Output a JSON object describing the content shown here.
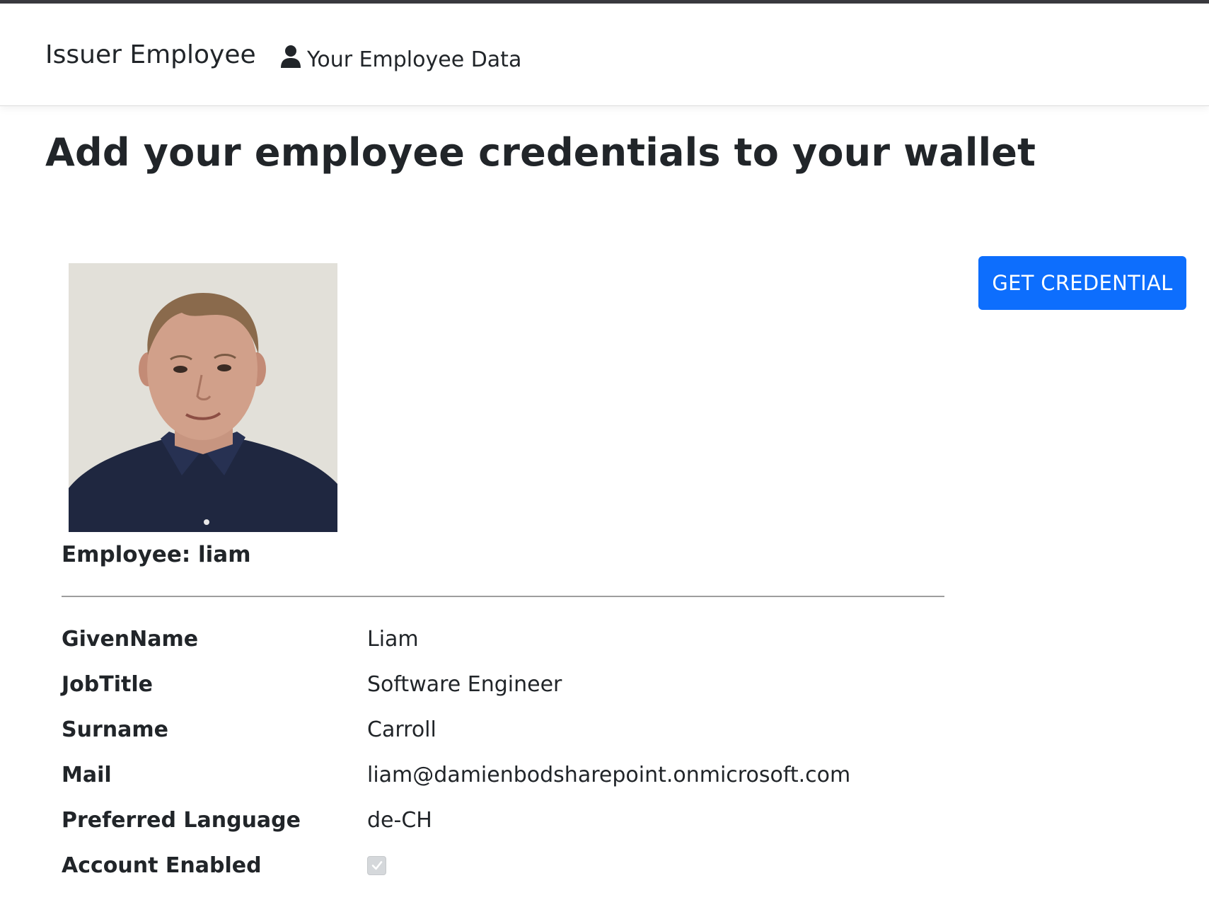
{
  "navbar": {
    "brand": "Issuer Employee",
    "link_label": "Your Employee Data",
    "link_icon": "person-icon"
  },
  "main": {
    "title": "Add your employee credentials to your wallet",
    "photo_alt": "Employee photo",
    "employee_heading": "Employee: liam",
    "get_credential_label": "GET CREDENTIAL",
    "accent_color": "#0d6efd"
  },
  "details": [
    {
      "label": "GivenName",
      "value": "Liam"
    },
    {
      "label": "JobTitle",
      "value": "Software Engineer"
    },
    {
      "label": "Surname",
      "value": "Carroll"
    },
    {
      "label": "Mail",
      "value": "liam@damienbodsharepoint.onmicrosoft.com"
    },
    {
      "label": "Preferred Language",
      "value": "de-CH"
    },
    {
      "label": "Account Enabled",
      "checked": true,
      "disabled": true
    }
  ]
}
